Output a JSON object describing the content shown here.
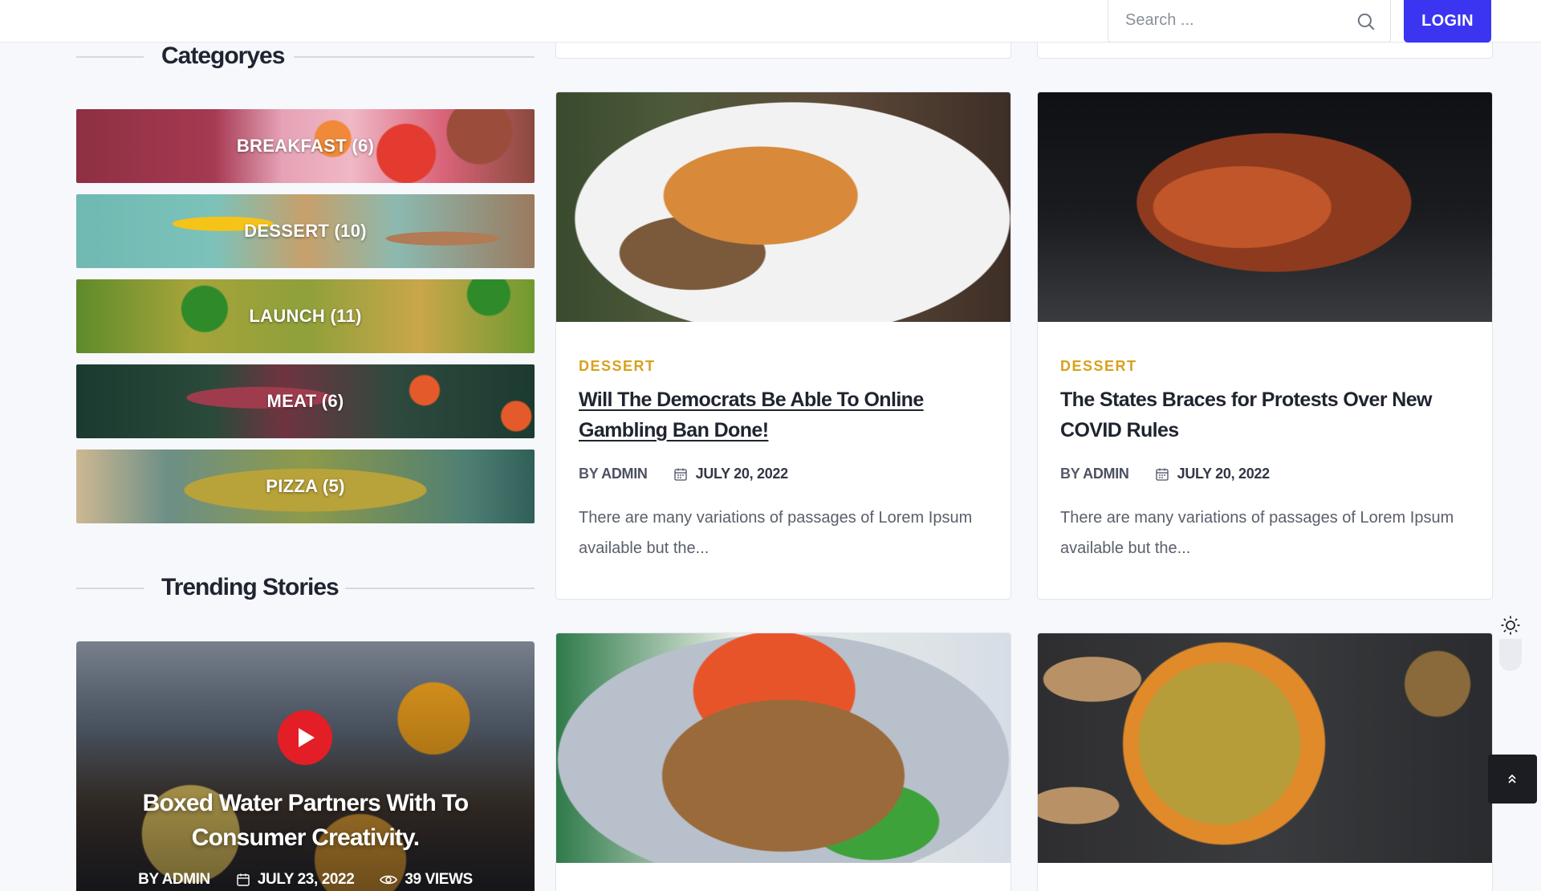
{
  "header": {
    "search_placeholder": "Search ...",
    "login_label": "LOGIN"
  },
  "sidebar": {
    "categories_title": "Categoryes",
    "categories": [
      {
        "label": "BREAKFAST (6)"
      },
      {
        "label": "DESSERT (10)"
      },
      {
        "label": "LAUNCH (11)"
      },
      {
        "label": "MEAT (6)"
      },
      {
        "label": "PIZZA (5)"
      }
    ],
    "trending_title": "Trending Stories",
    "trending": {
      "title": "Boxed Water Partners With To Consumer Creativity.",
      "author": "BY ADMIN",
      "date": "JULY 23, 2022",
      "views": "39 VIEWS"
    }
  },
  "posts": [
    {
      "category": "DESSERT",
      "title": "Will The Democrats Be Able To Online Gambling Ban Done!",
      "by": "BY",
      "author": "ADMIN",
      "date": "JULY 20, 2022",
      "excerpt": "There are many variations of passages of Lorem Ipsum available but the..."
    },
    {
      "category": "DESSERT",
      "title": "The States Braces for Protests Over New COVID Rules",
      "by": "BY",
      "author": "ADMIN",
      "date": "JULY 20, 2022",
      "excerpt": "There are many variations of passages of Lorem Ipsum available but the..."
    }
  ],
  "colors": {
    "accent": "#3b35f2",
    "category": "#d8a11e",
    "play": "#e41e26"
  }
}
